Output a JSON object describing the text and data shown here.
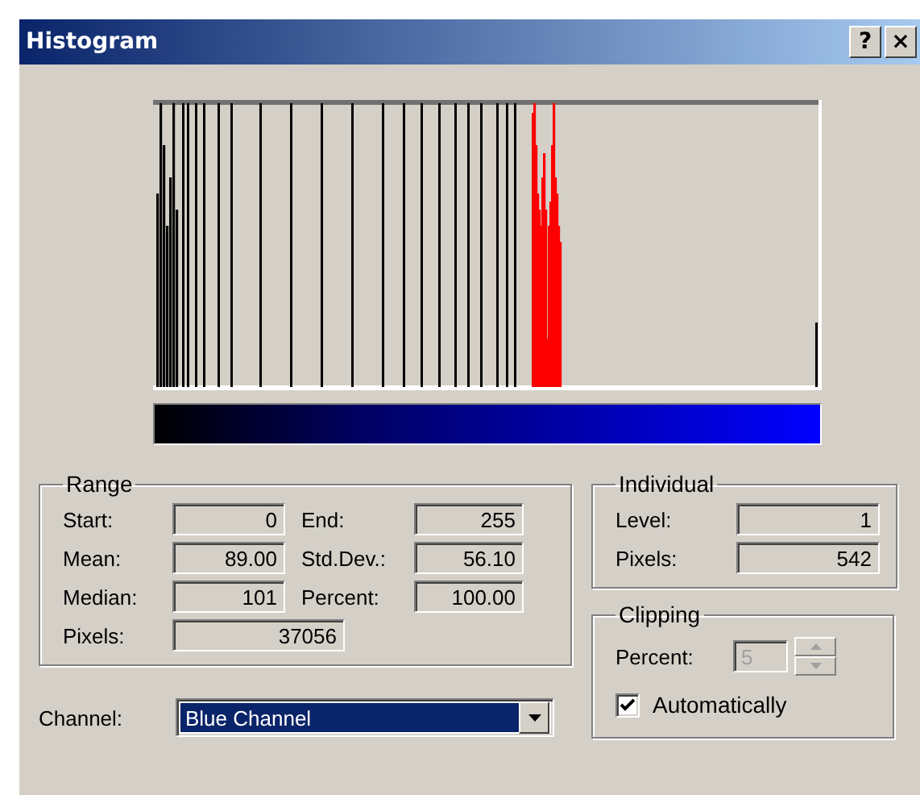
{
  "window": {
    "title": "Histogram",
    "title_buttons": [
      "?",
      "×"
    ]
  },
  "range": {
    "title": "Range",
    "rows": [
      {
        "fields": [
          {
            "label": "Start:",
            "value": "0"
          },
          {
            "label": "End:",
            "value": "255"
          }
        ]
      },
      {
        "fields": [
          {
            "label": "Mean:",
            "value": "89.00"
          },
          {
            "label": "Std.Dev.:",
            "value": "56.10"
          }
        ]
      },
      {
        "fields": [
          {
            "label": "Median:",
            "value": "101"
          },
          {
            "label": "Percent:",
            "value": "100.00"
          }
        ]
      },
      {
        "fields": [
          {
            "label": "Pixels:",
            "value": "37056"
          }
        ]
      }
    ]
  },
  "channel": {
    "label": "Channel:",
    "value": "Blue Channel"
  },
  "individual": {
    "title": "Individual",
    "fields": [
      {
        "label": "Level:",
        "value": "1"
      },
      {
        "label": "Pixels:",
        "value": "542"
      }
    ]
  },
  "clipping": {
    "title": "Clipping",
    "percent": {
      "label": "Percent:",
      "value": "5",
      "disabled": true
    },
    "checkbox": {
      "label": "Automatically",
      "checked": true
    }
  }
}
